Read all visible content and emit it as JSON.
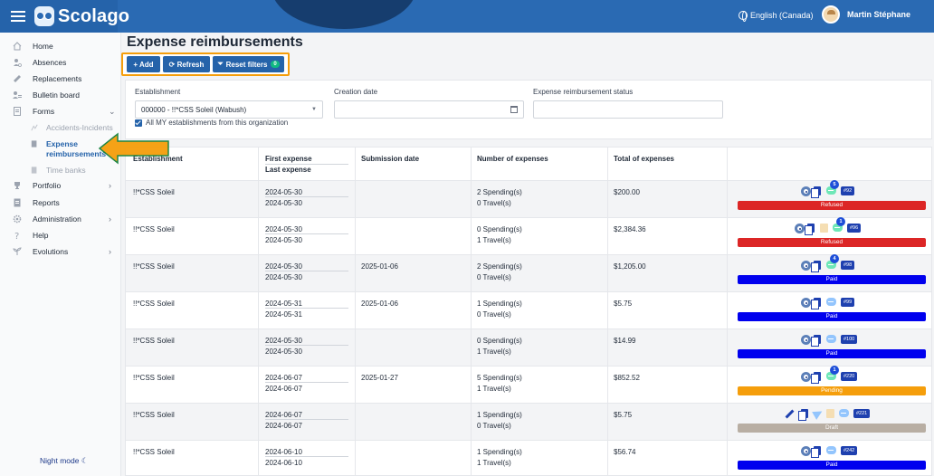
{
  "app": {
    "name": "Scolago"
  },
  "topbar": {
    "language": "English (Canada)",
    "user_name": "Martin Stéphane"
  },
  "sidebar": {
    "items": [
      {
        "label": "Home",
        "icon": "house-icon"
      },
      {
        "label": "Absences",
        "icon": "person-absent-icon"
      },
      {
        "label": "Replacements",
        "icon": "replace-icon"
      },
      {
        "label": "Bulletin board",
        "icon": "bulletin-icon"
      },
      {
        "label": "Forms",
        "icon": "form-icon",
        "chevron": "⌄"
      },
      {
        "label": "Portfolio",
        "icon": "trophy-icon",
        "chevron": "›"
      },
      {
        "label": "Reports",
        "icon": "report-icon"
      },
      {
        "label": "Administration",
        "icon": "gear-icon",
        "chevron": "›"
      },
      {
        "label": "Help",
        "icon": "question-icon"
      },
      {
        "label": "Evolutions",
        "icon": "sprout-icon",
        "chevron": "›"
      }
    ],
    "sub_items": [
      {
        "label": "Accidents-Incidents"
      },
      {
        "label_1": "Expense",
        "label_2": "reimbursements"
      },
      {
        "label": "Time banks"
      }
    ],
    "night_mode": "Night mode ☾"
  },
  "page": {
    "title": "Expense reimbursements"
  },
  "toolbar": {
    "add_label": "+  Add",
    "refresh_label": "⟳ Refresh",
    "reset_label": "Reset filters",
    "reset_count": "0"
  },
  "filters": {
    "establishment_label": "Establishment",
    "establishment_value": "000000 - !!*CSS Soleil (Wabush)",
    "creation_date_label": "Creation date",
    "creation_date_value": "",
    "status_label": "Expense reimbursement status",
    "status_value": "",
    "all_establishments_label": "All MY establishments from this organization"
  },
  "table": {
    "headers": {
      "establishment": "Establishment",
      "first_expense": "First expense",
      "last_expense": "Last expense",
      "submission_date": "Submission date",
      "number_of_expenses": "Number of expenses",
      "total_of_expenses": "Total of expenses"
    },
    "rows": [
      {
        "establishment": "!!*CSS Soleil",
        "first": "2024-05-30",
        "last": "2024-05-30",
        "submitted": "",
        "spending": "2 Spending(s)",
        "travel": "0 Travel(s)",
        "total": "$200.00",
        "comments": "5",
        "number": "#92",
        "status": "Refused",
        "actions": [
          "eye",
          "copy",
          "chat"
        ]
      },
      {
        "establishment": "!!*CSS Soleil",
        "first": "2024-05-30",
        "last": "2024-05-30",
        "submitted": "",
        "spending": "0 Spending(s)",
        "travel": "1 Travel(s)",
        "total": "$2,384.36",
        "comments": "1",
        "number": "#96",
        "status": "Refused",
        "actions": [
          "eye",
          "copy",
          "trash",
          "chat"
        ]
      },
      {
        "establishment": "!!*CSS Soleil",
        "first": "2024-05-30",
        "last": "2024-05-30",
        "submitted": "2025-01-06",
        "spending": "2 Spending(s)",
        "travel": "0 Travel(s)",
        "total": "$1,205.00",
        "comments": "4",
        "number": "#98",
        "status": "Paid",
        "actions": [
          "eye",
          "copy",
          "chat"
        ]
      },
      {
        "establishment": "!!*CSS Soleil",
        "first": "2024-05-31",
        "last": "2024-05-31",
        "submitted": "2025-01-06",
        "spending": "1 Spending(s)",
        "travel": "0 Travel(s)",
        "total": "$5.75",
        "comments": "",
        "number": "#99",
        "status": "Paid",
        "actions": [
          "eye",
          "copy",
          "chat"
        ]
      },
      {
        "establishment": "!!*CSS Soleil",
        "first": "2024-05-30",
        "last": "2024-05-30",
        "submitted": "",
        "spending": "0 Spending(s)",
        "travel": "1 Travel(s)",
        "total": "$14.99",
        "comments": "",
        "number": "#100",
        "status": "Paid",
        "actions": [
          "eye",
          "copy",
          "chat"
        ]
      },
      {
        "establishment": "!!*CSS Soleil",
        "first": "2024-06-07",
        "last": "2024-06-07",
        "submitted": "2025-01-27",
        "spending": "5 Spending(s)",
        "travel": "1 Travel(s)",
        "total": "$852.52",
        "comments": "1",
        "number": "#220",
        "status": "Pending",
        "actions": [
          "eye",
          "copy",
          "chat"
        ]
      },
      {
        "establishment": "!!*CSS Soleil",
        "first": "2024-06-07",
        "last": "2024-06-07",
        "submitted": "",
        "spending": "1 Spending(s)",
        "travel": "0 Travel(s)",
        "total": "$5.75",
        "comments": "",
        "number": "#221",
        "status": "Draft",
        "actions": [
          "pencil",
          "copy",
          "plane",
          "trash",
          "chat"
        ]
      },
      {
        "establishment": "!!*CSS Soleil",
        "first": "2024-06-10",
        "last": "2024-06-10",
        "submitted": "",
        "spending": "1 Spending(s)",
        "travel": "1 Travel(s)",
        "total": "$56.74",
        "comments": "",
        "number": "#242",
        "status": "Paid",
        "actions": [
          "eye",
          "copy",
          "chat"
        ]
      }
    ]
  },
  "colors": {
    "brand": "#2a6ab3",
    "highlight": "#f59e0b",
    "status_refused": "#dc2626",
    "status_paid": "#0000ee",
    "status_pending": "#f59e0b",
    "status_draft": "#b8aea3"
  }
}
